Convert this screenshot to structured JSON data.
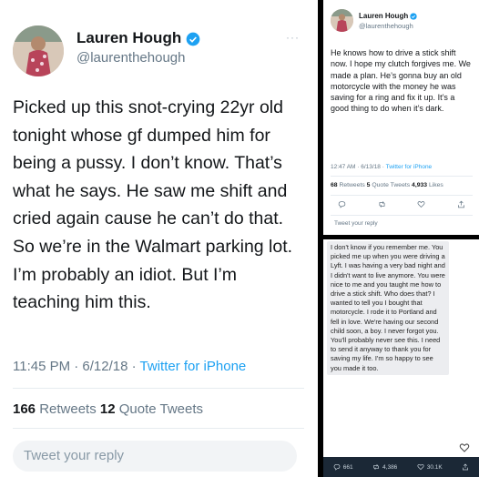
{
  "main": {
    "name": "Lauren Hough",
    "handle": "@laurenthehough",
    "more": "···",
    "text": "Picked up this snot-crying 22yr old tonight whose gf dumped him for being a pussy. I don’t know. That’s what he says. He saw me shift and cried again cause he can’t do that. So we’re in the Walmart parking lot. I’m probably an idiot. But I’m teaching him this.",
    "time": "11:45 PM · 6/12/18 · ",
    "source": "Twitter for iPhone",
    "retweets_count": "166",
    "retweets_label": " Retweets  ",
    "quotes_count": "12",
    "quotes_label": " Quote Tweets",
    "reply_placeholder": "Tweet your reply"
  },
  "followup": {
    "name": "Lauren Hough",
    "handle": "@laurenthehough",
    "text": "He knows how to drive a stick shift now. I hope my clutch forgives me. We made a plan. He’s gonna buy an old motorcycle with the money he was saving for a ring and fix it up. It’s a good thing to do when it’s dark.",
    "time": "12:47 AM · 6/13/18 · ",
    "source": "Twitter for iPhone",
    "retweets_count": "68",
    "retweets_label": " Retweets  ",
    "quotes_count": "5",
    "quotes_label": " Quote Tweets  ",
    "likes_count": "4,933",
    "likes_label": " Likes",
    "reply_placeholder": "Tweet your reply"
  },
  "message": {
    "text": "I don't know if you remember me. You picked me up when you were driving a Lyft. I was having a very bad night and I didn't want to live anymore. You were nice to me and you taught me how to drive a stick shift. Who does that? I wanted to tell you I bought that motorcycle. I rode it to Portland and fell in love. We're having our second child soon, a boy. I never forgot you. You'll probably never see this. I need to send it anyway to thank you for saving my life. I'm so happy to see you made it too.",
    "replies": "661",
    "retweets": "4,386",
    "likes": "30.1K"
  },
  "colors": {
    "link": "#1da1f2",
    "verified": "#1da1f2",
    "muted": "#657786",
    "text": "#14171a"
  },
  "icons": [
    "verified-badge-icon",
    "reply-icon",
    "retweet-icon",
    "like-icon",
    "share-icon"
  ]
}
